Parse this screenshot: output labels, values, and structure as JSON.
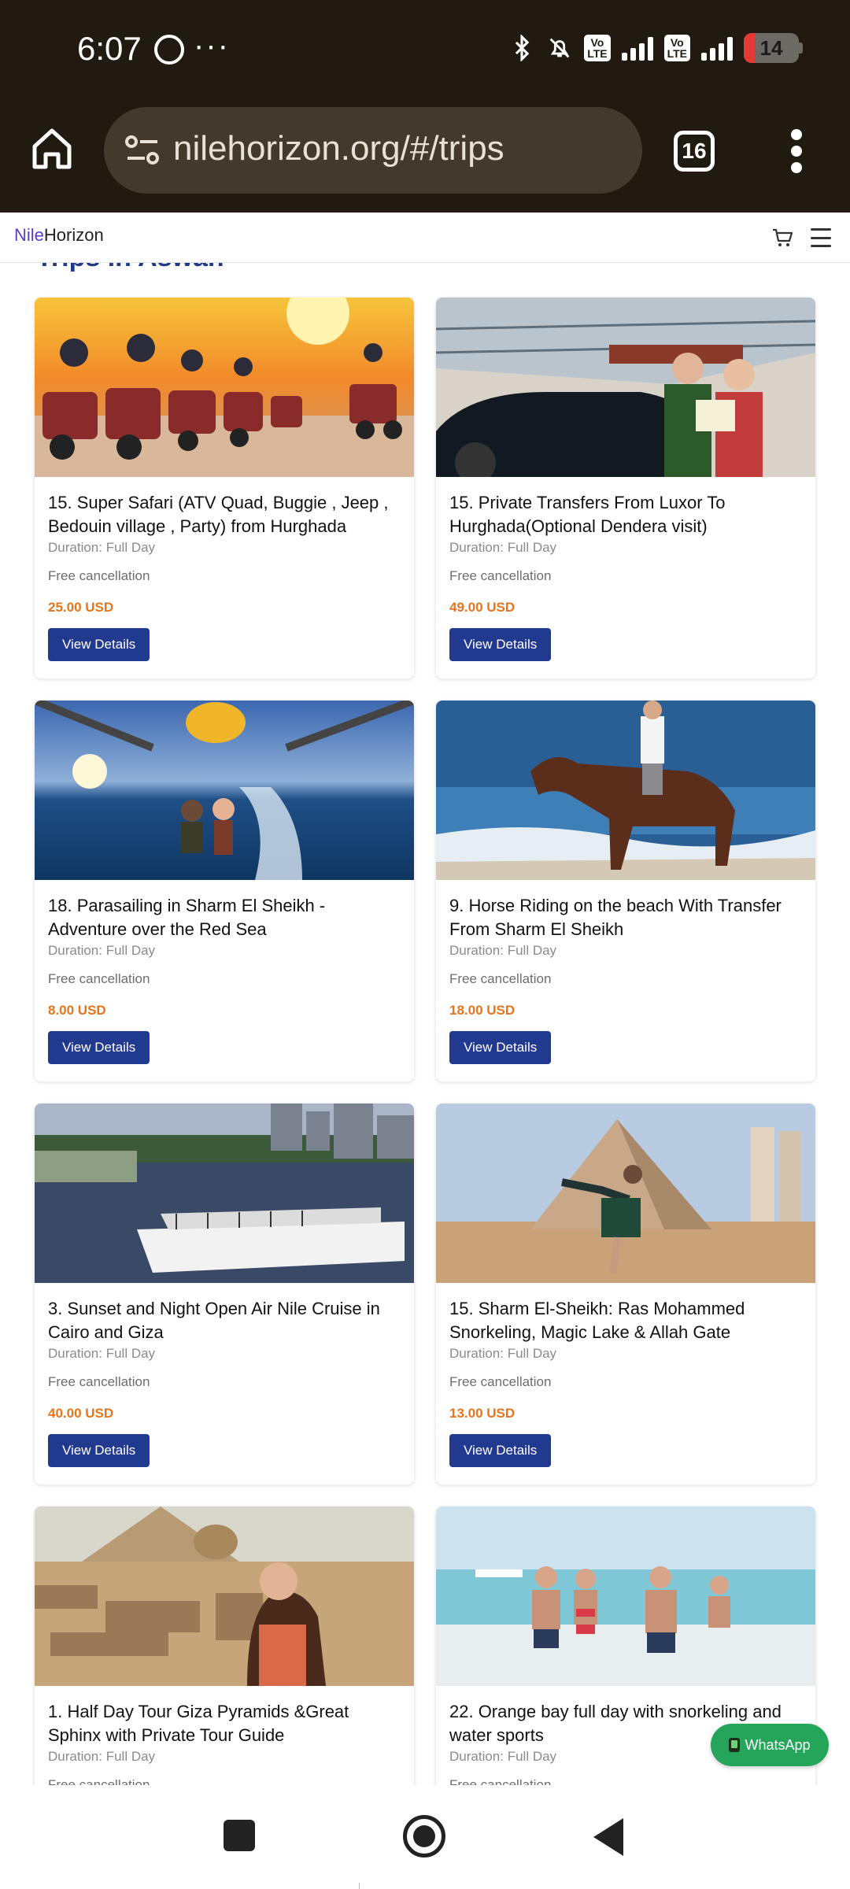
{
  "status_bar": {
    "time": "6:07",
    "volte_1": "Vo\nLTE",
    "volte_2": "Vo\nLTE",
    "network": "4G",
    "battery": "14"
  },
  "browser": {
    "url": "nilehorizon.org/#/trips",
    "tab_count": "16"
  },
  "site": {
    "logo_part1": "Nile",
    "logo_part2": "Horizon",
    "section_title": "Trips in Aswan"
  },
  "trips": [
    {
      "title": "15. Super Safari (ATV Quad, Buggie , Jeep , Bedouin village , Party) from Hurghada",
      "duration": "Duration: Full Day",
      "cancellation": "Free cancellation",
      "price": "25.00 USD",
      "button": "View Details"
    },
    {
      "title": "15. Private Transfers From Luxor To Hurghada(Optional Dendera visit)",
      "duration": "Duration: Full Day",
      "cancellation": "Free cancellation",
      "price": "49.00 USD",
      "button": "View Details"
    },
    {
      "title": "18. Parasailing in Sharm El Sheikh - Adventure over the Red Sea",
      "duration": "Duration: Full Day",
      "cancellation": "Free cancellation",
      "price": "8.00 USD",
      "button": "View Details"
    },
    {
      "title": "9. Horse Riding on the beach With Transfer From Sharm El Sheikh",
      "duration": "Duration: Full Day",
      "cancellation": "Free cancellation",
      "price": "18.00 USD",
      "button": "View Details"
    },
    {
      "title": "3. Sunset and Night Open Air Nile Cruise in Cairo and Giza",
      "duration": "Duration: Full Day",
      "cancellation": "Free cancellation",
      "price": "40.00 USD",
      "button": "View Details"
    },
    {
      "title": "15. Sharm El-Sheikh: Ras Mohammed Snorkeling, Magic Lake & Allah Gate",
      "duration": "Duration: Full Day",
      "cancellation": "Free cancellation",
      "price": "13.00 USD",
      "button": "View Details"
    },
    {
      "title": "1. Half Day Tour Giza Pyramids &Great Sphinx with Private Tour Guide",
      "duration": "Duration: Full Day",
      "cancellation": "Free cancellation",
      "price": "",
      "button": ""
    },
    {
      "title": "22. Orange bay full day with snorkeling and water sports",
      "duration": "Duration: Full Day",
      "cancellation": "Free cancellation",
      "price": "",
      "button": ""
    }
  ],
  "whatsapp_button": "WhatsApp",
  "colors": {
    "brand_blue": "#213a8f",
    "price_orange": "#e8751a",
    "logo_purple": "#5b3cc4",
    "whatsapp_green": "#25a55a"
  }
}
